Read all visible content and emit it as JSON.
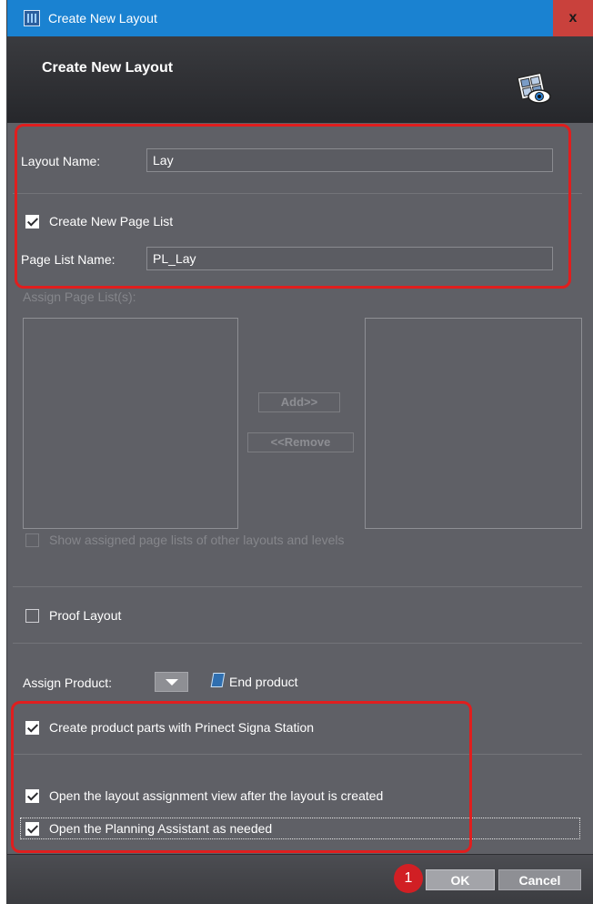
{
  "window": {
    "title": "Create New Layout",
    "close_label": "x"
  },
  "header": {
    "title": "Create New Layout"
  },
  "form": {
    "layout_name_label": "Layout Name:",
    "layout_name_value": "Lay",
    "create_page_list_label": "Create New Page List",
    "create_page_list_checked": true,
    "page_list_name_label": "Page List Name:",
    "page_list_name_value": "PL_Lay",
    "assign_page_lists_label": "Assign Page List(s):",
    "add_label": "Add>>",
    "remove_label": "<<Remove",
    "show_assigned_label": "Show assigned page lists of other layouts and levels",
    "show_assigned_checked": false,
    "proof_layout_label": "Proof Layout",
    "proof_layout_checked": false,
    "assign_product_label": "Assign Product:",
    "end_product_label": "End product",
    "create_product_parts_label": "Create product parts with Prinect Signa Station",
    "create_product_parts_checked": true,
    "open_assignment_view_label": "Open the layout assignment view after the layout is created",
    "open_assignment_view_checked": true,
    "open_planning_assistant_label": "Open the Planning Assistant as needed",
    "open_planning_assistant_checked": true
  },
  "footer": {
    "step_number": "1",
    "ok_label": "OK",
    "cancel_label": "Cancel"
  },
  "colors": {
    "dialog_bg": "#5f6066",
    "titlebar": "#1a82d1",
    "close_button": "#c9413c",
    "highlight": "#e01e1e",
    "step_badge": "#d11f24"
  },
  "icons": {
    "app": "layout-app-icon",
    "header": "layout-preview-eye-icon",
    "product": "end-product-icon",
    "dropdown": "chevron-down-icon"
  }
}
